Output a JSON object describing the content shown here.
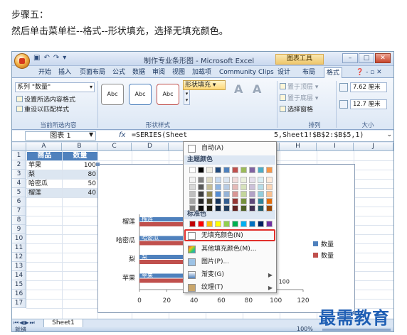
{
  "instructions": {
    "step": "步骤五：",
    "desc": "然后单击菜单栏--格式--形状填充，选择无填充颜色。"
  },
  "titlebar": {
    "title": "制作专业条形图 - Microsoft Excel",
    "context_tab": "图表工具"
  },
  "ribbon_tabs": [
    "开始",
    "插入",
    "页面布局",
    "公式",
    "数据",
    "审阅",
    "视图",
    "加载项",
    "Community Clips",
    "设计",
    "布局",
    "格式"
  ],
  "ribbon": {
    "current_selection_value": "系列 \"数量\"",
    "format_selection": "设置所选内容格式",
    "reset_style": "重设以匹配样式",
    "group_current": "当前所选内容",
    "group_shape_styles": "形状样式",
    "shape_style_samples": [
      "Abc",
      "Abc",
      "Abc"
    ],
    "shape_fill": "形状填充",
    "bring_front": "置于顶层",
    "send_back": "置于底层",
    "selection_pane": "选择窗格",
    "group_arrange": "排列",
    "group_size": "大小",
    "height": "7.62 厘米",
    "width": "12.7 厘米"
  },
  "formula_bar": {
    "name_box": "图表 1",
    "fx": "fx",
    "formula_left": "=SERIES(Sheet",
    "formula_right": "5,Sheet1!$B$2:$B$5,1)"
  },
  "columns": [
    "A",
    "B",
    "C",
    "D",
    "E",
    "F",
    "G",
    "H",
    "I",
    "J"
  ],
  "rows": [
    "1",
    "2",
    "3",
    "4",
    "5",
    "6",
    "7",
    "8",
    "9",
    "10",
    "11",
    "12",
    "13",
    "14",
    "15",
    "16",
    "17"
  ],
  "table": {
    "headers": [
      "商品",
      "数量"
    ],
    "rows": [
      {
        "name": "苹果",
        "qty": "100"
      },
      {
        "name": "梨",
        "qty": "80"
      },
      {
        "name": "哈密瓜",
        "qty": "50"
      },
      {
        "name": "榴莲",
        "qty": "40"
      }
    ]
  },
  "dropdown": {
    "auto": "自动(A)",
    "theme_colors": "主题颜色",
    "standard_colors": "标准色",
    "no_fill": "无填充颜色(N)",
    "more_colors": "其他填充颜色(M)...",
    "picture": "图片(P)...",
    "gradient": "渐变(G)",
    "texture": "纹理(T)"
  },
  "chart_data": {
    "type": "bar",
    "categories": [
      "苹果",
      "梨",
      "哈密瓜",
      "榴莲"
    ],
    "series": [
      {
        "name": "数量",
        "values": [
          100,
          80,
          50,
          40
        ],
        "color": "#4f81bd"
      },
      {
        "name": "数量",
        "values": [
          100,
          80,
          50,
          40
        ],
        "color": "#c0504d"
      }
    ],
    "xlim": [
      0,
      120
    ],
    "xticks": [
      "0",
      "20",
      "40",
      "60",
      "80",
      "100",
      "120"
    ],
    "bar_labels": [
      "100",
      "80",
      "50",
      "40"
    ],
    "inner_labels": [
      "苹果",
      "梨",
      "哈密瓜",
      "榴莲"
    ],
    "legend": "right"
  },
  "sheet_tab": "Sheet1",
  "status": {
    "ready": "就绪",
    "zoom": "100%"
  },
  "watermark": "最需教育",
  "theme_palette": [
    [
      "#ffffff",
      "#000000",
      "#eeece1",
      "#1f497d",
      "#4f81bd",
      "#c0504d",
      "#9bbb59",
      "#8064a2",
      "#4bacc6",
      "#f79646"
    ],
    [
      "#f2f2f2",
      "#7f7f7f",
      "#ddd9c3",
      "#c6d9f0",
      "#dbe5f1",
      "#f2dcdb",
      "#ebf1dd",
      "#e5e0ec",
      "#dbeef3",
      "#fdeada"
    ],
    [
      "#d8d8d8",
      "#595959",
      "#c4bd97",
      "#8db3e2",
      "#b8cce4",
      "#e5b9b7",
      "#d7e3bc",
      "#ccc1d9",
      "#b7dde8",
      "#fbd5b5"
    ],
    [
      "#bfbfbf",
      "#3f3f3f",
      "#938953",
      "#548dd4",
      "#95b3d7",
      "#d99694",
      "#c3d69b",
      "#b2a2c7",
      "#92cddc",
      "#fac08f"
    ],
    [
      "#a5a5a5",
      "#262626",
      "#494429",
      "#17365d",
      "#366092",
      "#953734",
      "#76923c",
      "#5f497a",
      "#31859b",
      "#e36c09"
    ],
    [
      "#7f7f7f",
      "#0c0c0c",
      "#1d1b10",
      "#0f243e",
      "#244061",
      "#632423",
      "#4f6128",
      "#3f3151",
      "#205867",
      "#974806"
    ]
  ],
  "standard_palette": [
    "#c00000",
    "#ff0000",
    "#ffc000",
    "#ffff00",
    "#92d050",
    "#00b050",
    "#00b0f0",
    "#0070c0",
    "#002060",
    "#7030a0"
  ]
}
